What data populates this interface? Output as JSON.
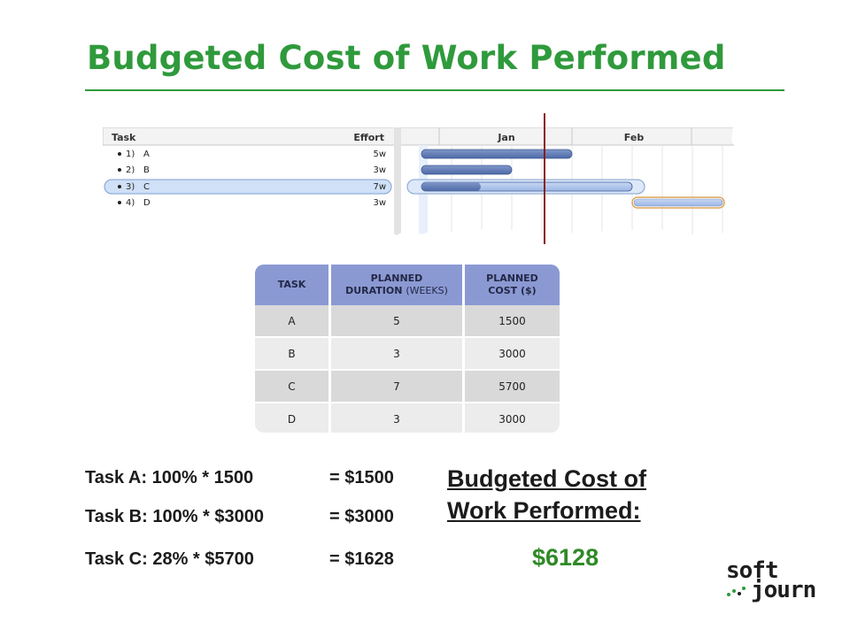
{
  "title": "Budgeted Cost of Work Performed",
  "gantt": {
    "headers": {
      "task": "Task",
      "effort": "Effort",
      "month1": "Jan",
      "month2": "Feb"
    },
    "rows": [
      {
        "id": "1)",
        "name": "A",
        "effort": "5w",
        "selected": false
      },
      {
        "id": "2)",
        "name": "B",
        "effort": "3w",
        "selected": false
      },
      {
        "id": "3)",
        "name": "C",
        "effort": "7w",
        "selected": true,
        "progress": 0.28
      },
      {
        "id": "4)",
        "name": "D",
        "effort": "3w",
        "selected": false
      }
    ],
    "colors": {
      "bar": "#5b78b3",
      "bar_light": "#a9c2ea",
      "selection": "#cfe0f7",
      "marker": "#8b1a1a"
    }
  },
  "table": {
    "headers": [
      {
        "main": "TASK",
        "sub": ""
      },
      {
        "main": "PLANNED",
        "main2": "DURATION",
        "sub": "(WEEKS)"
      },
      {
        "main": "PLANNED",
        "main2": "COST ($)",
        "sub": ""
      }
    ],
    "rows": [
      [
        "A",
        "5",
        "1500"
      ],
      [
        "B",
        "3",
        "3000"
      ],
      [
        "C",
        "7",
        "5700"
      ],
      [
        "D",
        "3",
        "3000"
      ]
    ],
    "colors": {
      "header": "#8b99d3",
      "row_odd": "#d9d9d9",
      "row_even": "#ececec"
    }
  },
  "calc": [
    {
      "expr": "Task A: 100% * 1500",
      "result": "= $1500"
    },
    {
      "expr": "Task B: 100% * $3000",
      "result": "= $3000"
    },
    {
      "expr": "Task C: 28% * $5700",
      "result": "= $1628"
    }
  ],
  "summary": {
    "label": "Budgeted Cost of Work Performed:",
    "value": "$6128"
  },
  "logo": {
    "line1": "soft",
    "line2": "journ"
  },
  "colors": {
    "accent": "#2f9a3c",
    "value": "#2f8a27"
  }
}
